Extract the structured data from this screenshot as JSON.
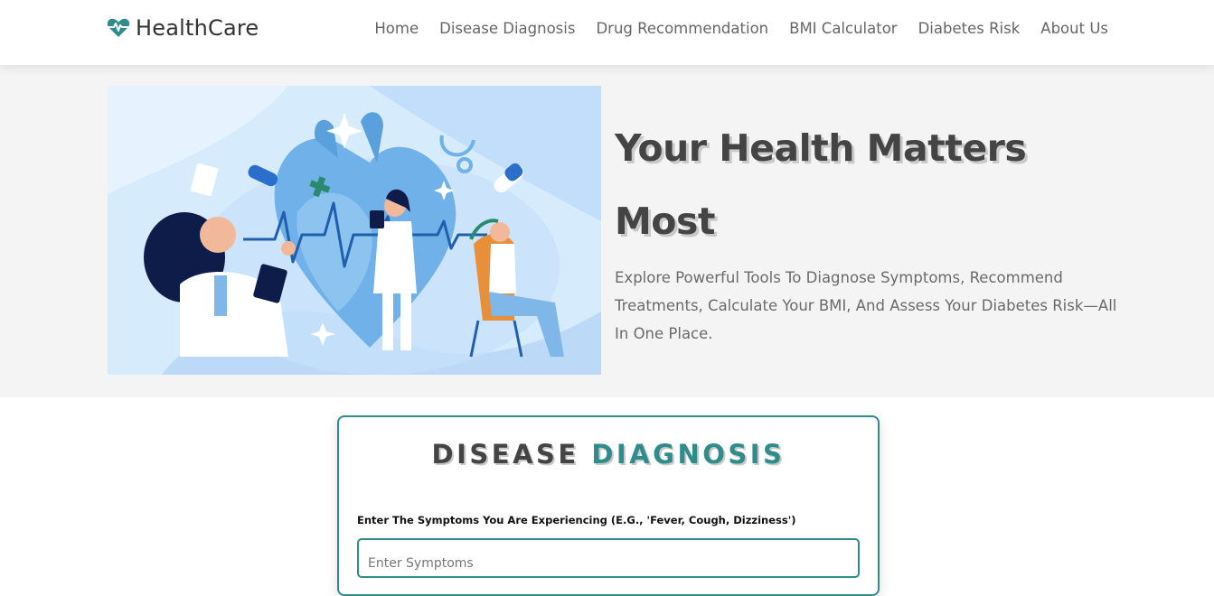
{
  "brand": {
    "name": "HealthCare",
    "icon": "heart-pulse-icon"
  },
  "nav": {
    "items": [
      {
        "label": "Home"
      },
      {
        "label": "Disease Diagnosis"
      },
      {
        "label": "Drug Recommendation"
      },
      {
        "label": "BMI Calculator"
      },
      {
        "label": "Diabetes Risk"
      },
      {
        "label": "About Us"
      }
    ]
  },
  "hero": {
    "title": "Your Health Matters Most",
    "description": "Explore Powerful Tools To Diagnose Symptoms, Recommend Treatments, Calculate Your BMI, And Assess Your Diabetes Risk—All In One Place.",
    "illustration": "doctors-heart-illustration"
  },
  "diagnosis": {
    "title_part1": "DISEASE",
    "title_part2": "DIAGNOSIS",
    "label": "Enter The Symptoms You Are Experiencing (E.G., 'Fever, Cough, Dizziness')",
    "input_placeholder": "Enter Symptoms",
    "input_value": ""
  },
  "colors": {
    "accent": "#2f8c8a",
    "hero_bg": "#f4f4f4",
    "text": "#444444"
  }
}
